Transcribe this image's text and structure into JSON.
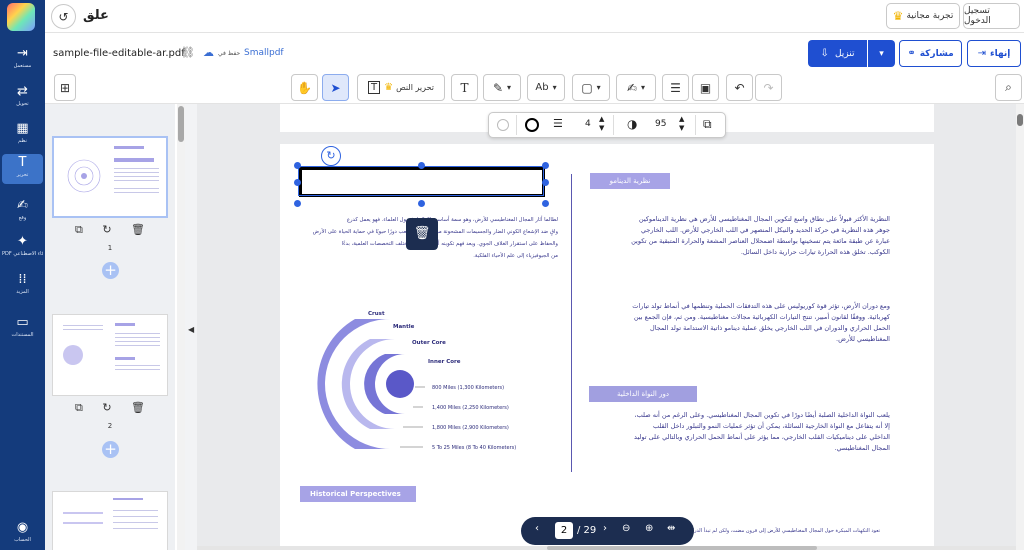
{
  "colors": {
    "nav": "#143b7c",
    "primary": "#1f4fd1",
    "accent": "#a7a3e6",
    "pager": "#1c2d50"
  },
  "nav": {
    "logo": "smallpdf-logo-icon",
    "items": [
      {
        "label": "مستعمل",
        "icon": "home-icon"
      },
      {
        "label": "تحويل",
        "icon": "convert-icon"
      },
      {
        "label": "نظم",
        "icon": "grid-icon"
      },
      {
        "label": "تحرير",
        "icon": "text-edit-icon"
      },
      {
        "label": "وقع",
        "icon": "sign-icon"
      },
      {
        "label": "PDF الذكاء الاصطناعي",
        "icon": "ai-sparkle-icon"
      },
      {
        "label": "المزيد",
        "icon": "more-icon"
      },
      {
        "label": "المستندات",
        "icon": "folder-icon"
      },
      {
        "label": "الحساب",
        "icon": "account-icon"
      }
    ]
  },
  "topbar": {
    "close_label": "علق",
    "login_label": "تسجيل الدخول",
    "trial_label": "تجربة مجانية"
  },
  "titlebar": {
    "filename": "sample-file-editable-ar.pdf",
    "saved_in": "حفظ في",
    "service": "Smallpdf",
    "download_label": "تنزيل",
    "share_label": "مشاركة",
    "finish_label": "إنهاء"
  },
  "toolbar": {
    "edit_text_label": "تحرير النص"
  },
  "context": {
    "stroke_width": "4",
    "opacity": "95"
  },
  "thumbnails": {
    "pages": [
      "1",
      "2"
    ]
  },
  "doc": {
    "heading1": "نظرية الدينامو",
    "heading2": "دور النواة الداخلية",
    "heading3": "Historical Perspectives",
    "right_para1": [
      "النظرية الأكثر قبولاً على نطاق واسع لتكوين المجال المغناطيسي للأرض هي نظرية الديناموكين",
      "جوهر هذه النظرية في حركة الحديد والنيكل المنصهر في اللب الخارجي للأرض. اللب الخارجي",
      "عبارة عن طبقة مائعة يتم تسخينها بواسطة اضمحلال العناصر المشعة والحرارة المتبقية من تكوين",
      "الكوكب. تخلق هذه الحرارة تيارات حرارية داخل السائل."
    ],
    "right_para2": [
      "ومع دوران الأرض، تؤثر قوة كوريوليس على هذه التدفقات الحملية وتنظمها في أنماط تولد تيارات",
      "كهربائية. ووفقًا لقانون أمبير، تنتج التيارات الكهربائية مجالات مغناطيسية. ومن ثم، فإن الجمع بين",
      "الحمل الحراري والدوران في اللب الخارجي يخلق عملية دينامو ذاتية الاستدامة تولد المجال",
      "المغناطيسي للأرض."
    ],
    "right_para3": [
      "يلعب النواة الداخلية الصلبة أيضًا دورًا في تكوين المجال المغناطيسي. وعلى الرغم من أنه صلب،",
      "إلا أنه يتفاعل مع النواة الخارجية السائلة، يمكن أن تؤثر عمليات النمو والتبلور داخل القلب",
      "الداخلي على ديناميكيات القلب الخارجي، مما يؤثر على أنماط الحمل الحراري وبالتالي على توليد",
      "المجال المغناطيسي."
    ],
    "left_para": [
      "لطالما أثار المجال المغناطيسي للأرض، وهو سمة أساسية لكوكبنا، فضول العلماء. فهو يعمل كدرع",
      "واقٍ ضد الإشعاع الكوني الضار والجسيمات المشحونة من الشمس، ويلعب دورًا حيويًا في حماية الحياة على الأرض",
      "والحفاظ على استقرار الغلاف الجوي. ويعد فهم تكوينه أمرًا أساسيًا لمختلف التخصصات العلمية، بدءًا",
      "من الجيوفيزياء إلى علم الأحياء الفلكية."
    ],
    "bottom_line": "تعود التكهنات المبكرة حول المجال المغناطيسي للأرض إلى قرون مضت، ولكن لم تبدأ الدراسات الأكثر منهجية حتى الثورة العلمية. فقد قدم علماء مثل ويليام جيلبرت",
    "diagram_labels": [
      "Crust",
      "Mantle",
      "Outer Core",
      "Inner Core"
    ],
    "depths": [
      "800 Miles (1,300 Kilometers)",
      "1,400 Miles (2,250 Kilometers)",
      "1,800 Miles (2,900 Kilometers)",
      "5 To 25 Miles (8 To 40 Kilometers)"
    ]
  },
  "pager": {
    "current": "2",
    "total": "/ 29"
  }
}
